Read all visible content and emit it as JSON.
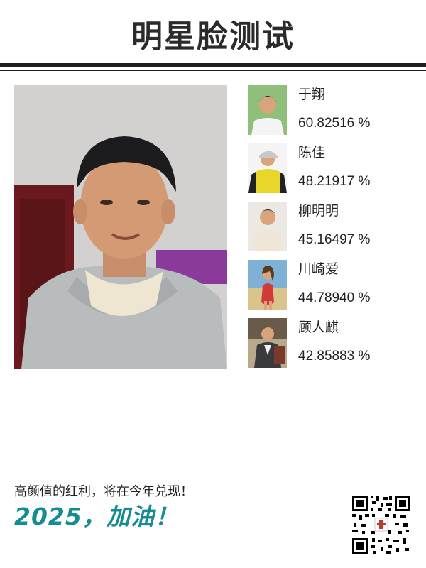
{
  "page": {
    "title": "明星脸测试"
  },
  "results": [
    {
      "name": "于翔",
      "score": "60.82516 %"
    },
    {
      "name": "陈佳",
      "score": "48.21917 %"
    },
    {
      "name": "柳明明",
      "score": "45.16497 %"
    },
    {
      "name": "川崎爱",
      "score": "44.78940 %"
    },
    {
      "name": "顾人麒",
      "score": "42.85883 %"
    }
  ],
  "footer": {
    "tagline": "高颜值的红利，将在今年兑现！",
    "cheer": "2025，加油！"
  },
  "colors": {
    "accent": "#138c93",
    "rule": "#1e1e1e"
  },
  "icons": {
    "qr": "qr-code-icon"
  }
}
